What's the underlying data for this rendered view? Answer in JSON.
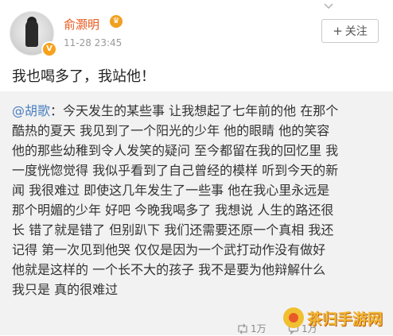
{
  "post": {
    "author": "俞灏明",
    "timestamp": "11-28 23:45",
    "follow_label": "关注",
    "follow_plus": "+",
    "text": "我也喝多了，我站他！"
  },
  "repost": {
    "mention": "@胡歌",
    "lines": [
      "：今天发生的某些事 让我想起了七年前的他 在那个",
      "酷热的夏天 我见到了一个阳光的少年 他的眼睛 他的笑容",
      "他的那些幼稚到令人发笑的疑问 至今都留在我的回忆里 我",
      "一度恍惚觉得 我似乎看到了自己曾经的模样 听到今天的新",
      "闻 我很难过 即使这几年发生了一些事 他在我心里永远是",
      "那个明媚的少年 好吧 今晚我喝多了 我想说 人生的路还很",
      "长 错了就是错了 但别趴下 我们还需要还原一个真相 我还",
      "记得 第一次见到他哭 仅仅是因为一个武打动作没有做好",
      "他就是这样的 一个长不大的孩子 我不是要为他辩解什么",
      "我只是 真的很难过"
    ],
    "stats": {
      "repost_count": "1万",
      "comment_count": "1万"
    }
  },
  "watermark": {
    "text": "茶归手游网"
  },
  "colors": {
    "author": "#e8581c",
    "mention": "#4a7fbf",
    "repost_bg": "#f2f2f2"
  }
}
